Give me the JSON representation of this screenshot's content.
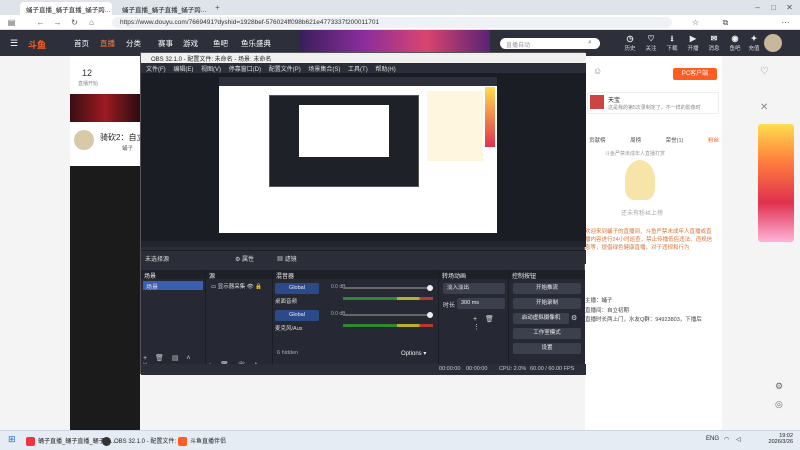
{
  "browser": {
    "tabs": [
      {
        "label": "蛹子直播_蛹子直播_蛹子跨..."
      },
      {
        "label": "蛹子直播_蛹子直播_蛹子跨..."
      }
    ],
    "url": "https://www.douyu.com/7669491?dyshid=1928bef-576024ff098b621e4773337f200011701"
  },
  "douyu": {
    "logo": "斗鱼",
    "nav": [
      "首页",
      "直播",
      "分类",
      "赛事",
      "游戏",
      "鱼吧",
      "鱼乐盛典"
    ],
    "search_placeholder": "直播自动",
    "header_icons": [
      "历史",
      "关注",
      "下载",
      "开播",
      "消息",
      "鱼吧",
      "充值"
    ],
    "streamer_title": "骑砍2：自立",
    "streamer_name": "蛹子",
    "followers": "12",
    "follow_label": "直播开始",
    "rank_btn": "PC客户端",
    "tabs": [
      "贡献榜",
      "周榜",
      "荣誉(1)",
      "粉丝"
    ],
    "chat_notice": "斗鱼严禁未成年人直播打赏",
    "ad_title": "天宝",
    "ad_sub": "这是我的第5次录制定了，不一样的影像时",
    "chat": [
      "欢迎来到蛹子的直播间，斗鱼严禁未成年人直播或直播内容进行24小时巡查，禁止传播低俗违法、违规信息等，提倡绿色健康直播，对于违规和行为",
      "主播：蛹子",
      "直播间：自立初期",
      "直播时长两上门，水友Q群：94923803，下播后"
    ],
    "cartoon_caption": "还未有粉丝上榜"
  },
  "obs": {
    "title": "OBS 32.1.0 - 配置文件: 未命名 - 场景: 未命名",
    "menu": [
      "文件(F)",
      "编辑(E)",
      "视图(V)",
      "停靠窗口(D)",
      "配置文件(P)",
      "场景集合(S)",
      "工具(T)",
      "帮助(H)"
    ],
    "no_source": "未选择源",
    "props": "属性",
    "filters": "滤镜",
    "scenes_label": "场景",
    "scene_item": "场景",
    "sources_label": "源",
    "source_item": "显示器采集",
    "mixer_label": "混音器",
    "mixer": [
      {
        "name": "桌面音频",
        "level": "0.0 dB"
      },
      {
        "name": "麦克风/Aux",
        "level": "0.0 dB"
      }
    ],
    "global": "Global",
    "hidden": "6 hidden",
    "options": "Options",
    "transitions_label": "转场动画",
    "transition": "淡入淡出",
    "duration_label": "时长",
    "duration": "300 ms",
    "controls_label": "控制按钮",
    "controls": [
      "开始推流",
      "开始录制",
      "启动虚拟摄像机",
      "工作室模式",
      "设置"
    ],
    "status_time1": "00:00:00",
    "status_time2": "00:00:00",
    "cpu": "CPU: 2.0%",
    "fps": "60.00 / 60.00 FPS"
  },
  "taskbar": {
    "items": [
      "蛹子直播_蛹子直播_蛹子跨...",
      "OBS 32.1.0 - 配置文件: 未",
      "斗鱼直播伴侣"
    ],
    "lang": "ENG",
    "time": "19:02",
    "date": "2026/3/26"
  }
}
